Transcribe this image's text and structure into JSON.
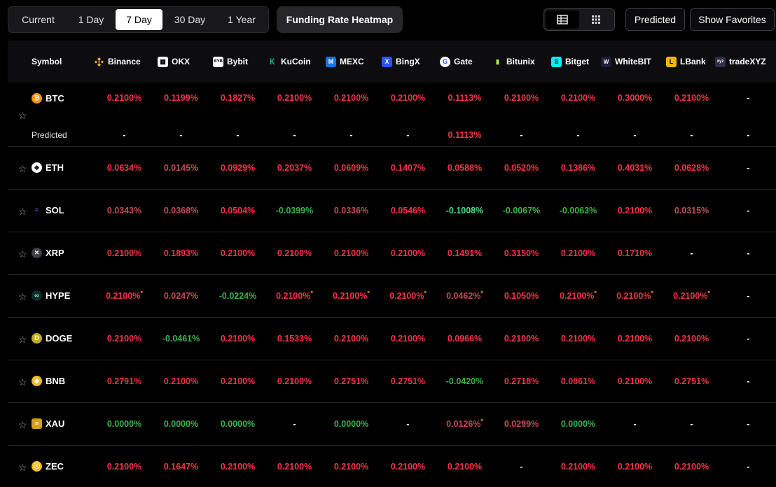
{
  "tabs": [
    {
      "label": "Current",
      "active": false
    },
    {
      "label": "1 Day",
      "active": false
    },
    {
      "label": "7 Day",
      "active": true
    },
    {
      "label": "30 Day",
      "active": false
    },
    {
      "label": "1 Year",
      "active": false
    }
  ],
  "heatmap_button": "Funding Rate Heatmap",
  "predicted_button": "Predicted",
  "favorites_button": "Show Favorites",
  "columns": {
    "symbol": "Symbol",
    "exchanges": [
      "Binance",
      "OKX",
      "Bybit",
      "KuCoin",
      "MEXC",
      "BingX",
      "Gate",
      "Bitunix",
      "Bitget",
      "WhiteBIT",
      "LBank",
      "tradeXYZ"
    ]
  },
  "btc": {
    "symbol": "BTC",
    "rates": [
      "0.2100%",
      "0.1199%",
      "0.1827%",
      "0.2100%",
      "0.2100%",
      "0.2100%",
      "0.1113%",
      "0.2100%",
      "0.2100%",
      "0.3000%",
      "0.2100%",
      "-"
    ],
    "predicted_label": "Predicted",
    "predicted": [
      "-",
      "-",
      "-",
      "-",
      "-",
      "-",
      "0.1113%",
      "-",
      "-",
      "-",
      "-",
      "-"
    ]
  },
  "rows": [
    {
      "symbol": "ETH",
      "rates": [
        "0.0634%",
        "0.0145%",
        "0.0929%",
        "0.2037%",
        "0.0609%",
        "0.1407%",
        "0.0588%",
        "0.0520%",
        "0.1386%",
        "0.4031%",
        "0.0628%",
        "-"
      ]
    },
    {
      "symbol": "SOL",
      "rates": [
        "0.0343%",
        "0.0368%",
        "0.0504%",
        "-0.0399%",
        "0.0336%",
        "0.0546%",
        "-0.1008%",
        "-0.0067%",
        "-0.0063%",
        "0.2100%",
        "0.0315%",
        "-"
      ]
    },
    {
      "symbol": "XRP",
      "rates": [
        "0.2100%",
        "0.1893%",
        "0.2100%",
        "0.2100%",
        "0.2100%",
        "0.2100%",
        "0.1491%",
        "0.3150%",
        "0.2100%",
        "0.1710%",
        "-",
        "-"
      ]
    },
    {
      "symbol": "HYPE",
      "rates": [
        "0.2100%",
        "0.0247%",
        "-0.0224%",
        "0.2100%",
        "0.2100%",
        "0.2100%",
        "0.0462%",
        "0.1050%",
        "0.2100%",
        "0.2100%",
        "0.2100%",
        "-"
      ]
    },
    {
      "symbol": "DOGE",
      "rates": [
        "0.2100%",
        "-0.0461%",
        "0.2100%",
        "0.1533%",
        "0.2100%",
        "0.2100%",
        "0.0966%",
        "0.2100%",
        "0.2100%",
        "0.2100%",
        "0.2100%",
        "-"
      ]
    },
    {
      "symbol": "BNB",
      "rates": [
        "0.2791%",
        "0.2100%",
        "0.2100%",
        "0.2100%",
        "0.2751%",
        "0.2751%",
        "-0.0420%",
        "0.2718%",
        "0.0861%",
        "0.2100%",
        "0.2751%",
        "-"
      ]
    },
    {
      "symbol": "XAU",
      "rates": [
        "0.0000%",
        "0.0000%",
        "0.0000%",
        "-",
        "0.0000%",
        "-",
        "0.0126%",
        "0.0299%",
        "0.0000%",
        "-",
        "-",
        "-"
      ]
    },
    {
      "symbol": "ZEC",
      "rates": [
        "0.2100%",
        "0.1647%",
        "0.2100%",
        "0.2100%",
        "0.2100%",
        "0.2100%",
        "0.2100%",
        "-",
        "0.2100%",
        "0.2100%",
        "0.2100%",
        "-"
      ]
    }
  ],
  "colors": {
    "positive": "#f23645",
    "negative": "#3ab34a",
    "accent_marker": "#f59e0b"
  }
}
